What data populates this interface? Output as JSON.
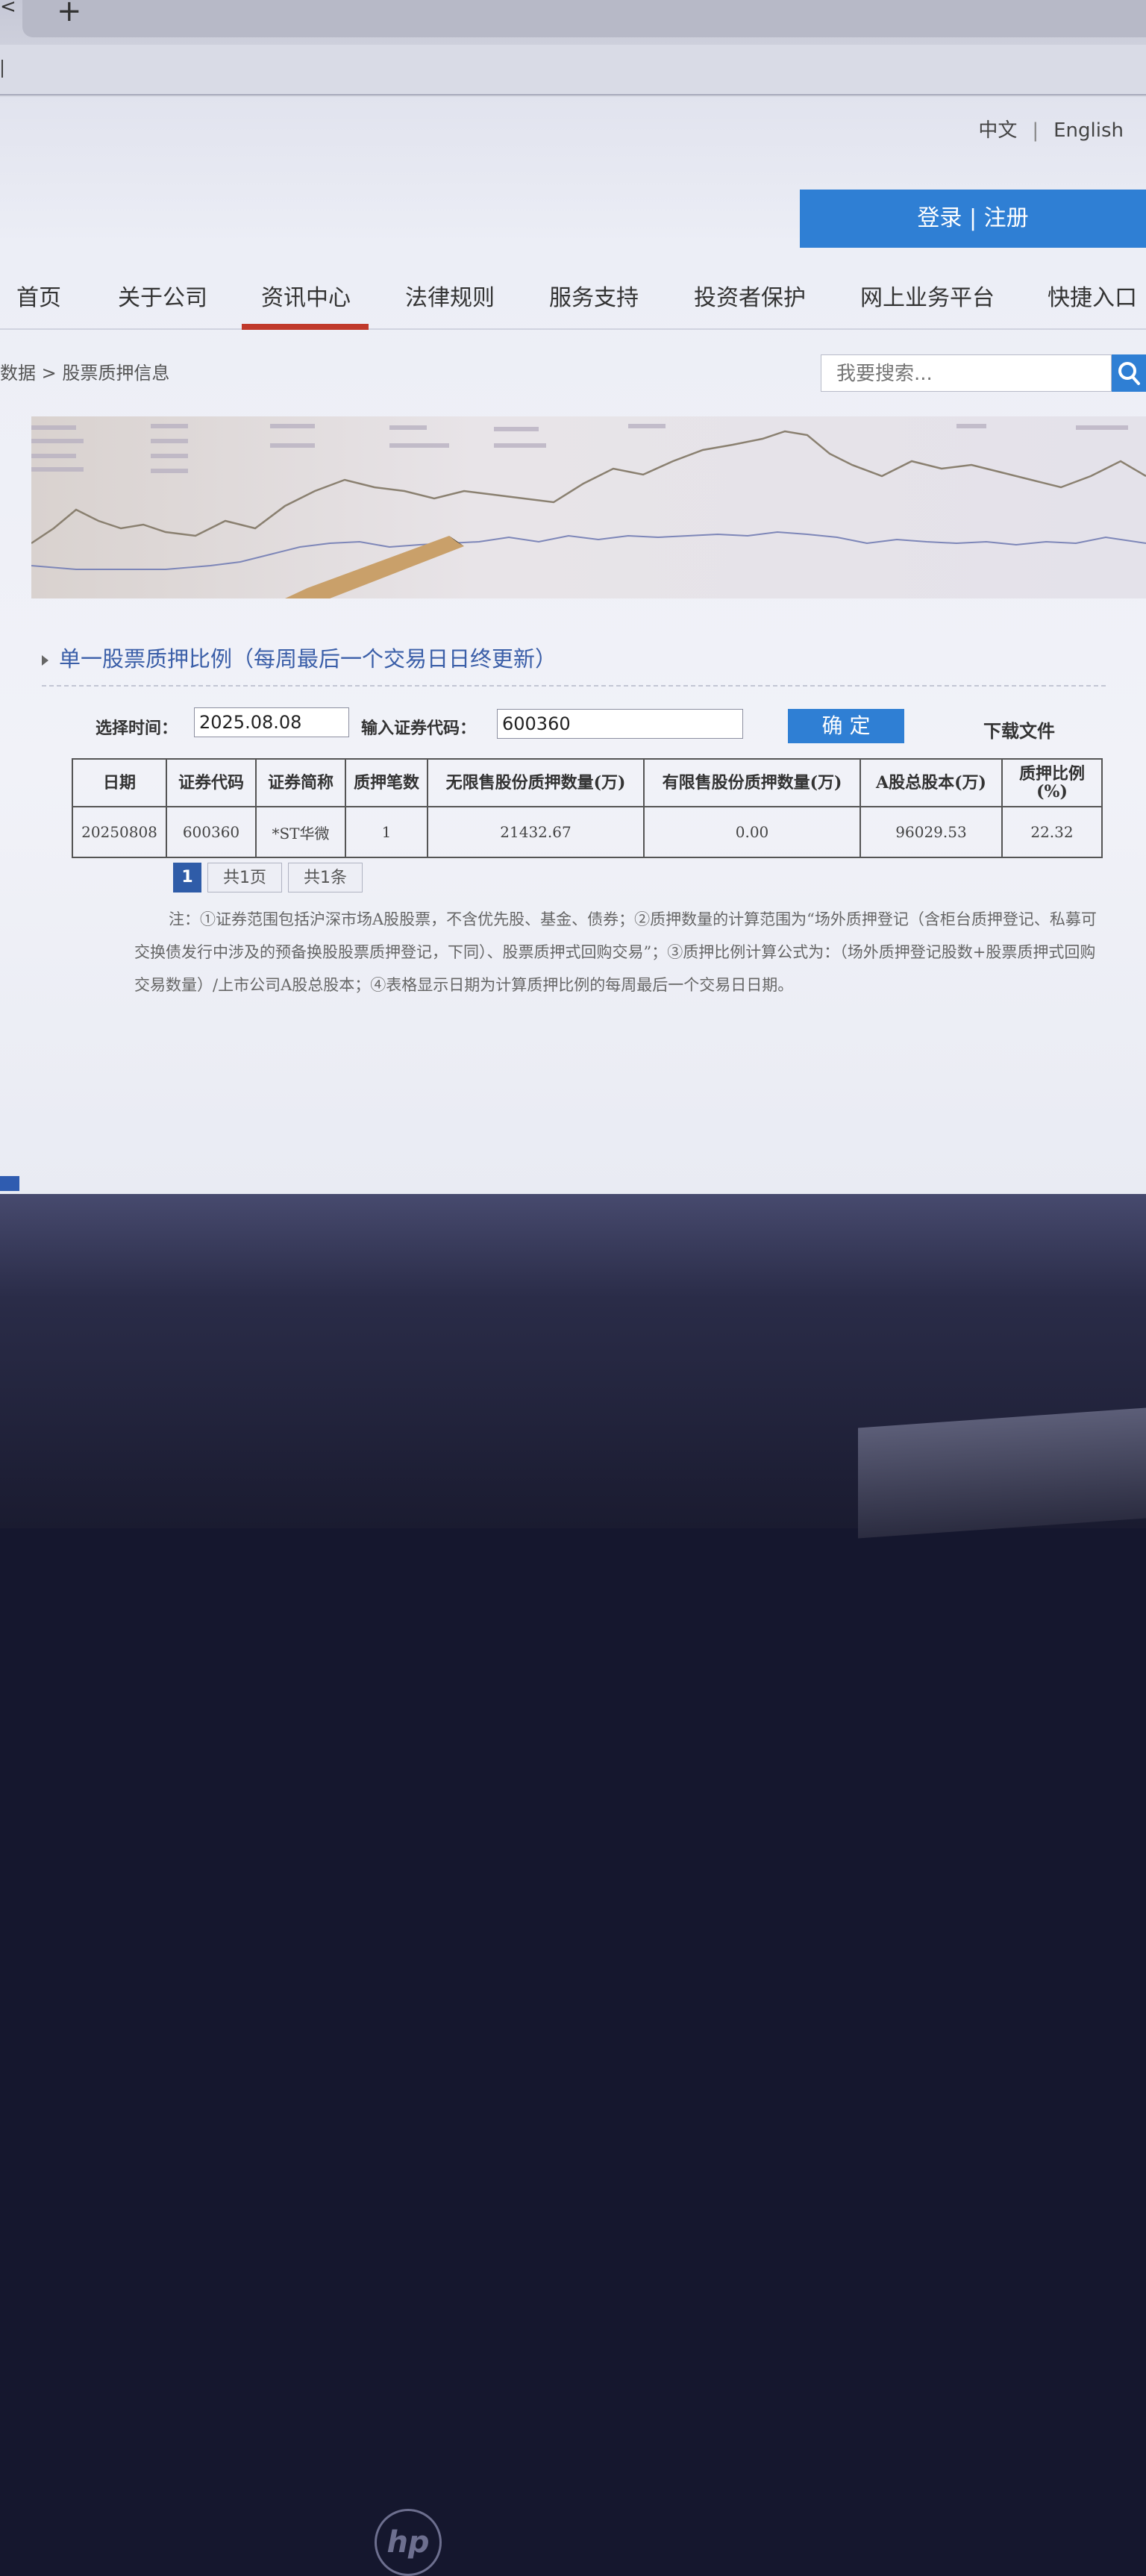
{
  "browser": {
    "new_tab_symbol": "+",
    "back_symbol": "<"
  },
  "header": {
    "lang_zh": "中文",
    "lang_sep": "|",
    "lang_en": "English",
    "login_register": "登录 | 注册"
  },
  "nav": {
    "items": [
      "首页",
      "关于公司",
      "资讯中心",
      "法律规则",
      "服务支持",
      "投资者保护",
      "网上业务平台",
      "快捷入口"
    ],
    "active_index": 2
  },
  "breadcrumb": "数据 > 股票质押信息",
  "search": {
    "placeholder": "我要搜索..."
  },
  "section": {
    "title": "单一股票质押比例（每周最后一个交易日日终更新）"
  },
  "form": {
    "time_label": "选择时间：",
    "time_value": "2025.08.08",
    "code_label": "输入证券代码：",
    "code_value": "600360",
    "confirm": "确 定",
    "download": "下载文件"
  },
  "table": {
    "headers": [
      "日期",
      "证券代码",
      "证券简称",
      "质押笔数",
      "无限售股份质押数量(万)",
      "有限售股份质押数量(万)",
      "A股总股本(万)",
      "质押比例(%)"
    ],
    "rows": [
      [
        "20250808",
        "600360",
        "*ST华微",
        "1",
        "21432.67",
        "0.00",
        "96029.53",
        "22.32"
      ]
    ]
  },
  "pager": {
    "current": "1",
    "pages": "共1页",
    "records": "共1条"
  },
  "note": "注：①证券范围包括沪深市场A股股票，不含优先股、基金、债券；②质押数量的计算范围为“场外质押登记（含柜台质押登记、私募可交换债发行中涉及的预备换股股票质押登记，下同）、股票质押式回购交易”；③质押比例计算公式为：（场外质押登记股数+股票质押式回购交易数量）/上市公司A股总股本；④表格显示日期为计算质押比例的每周最后一个交易日日期。",
  "device": {
    "brand": "hp"
  },
  "colors": {
    "accent": "#2f7fd4",
    "active_underline": "#c0392b",
    "title": "#3a5ea8"
  }
}
